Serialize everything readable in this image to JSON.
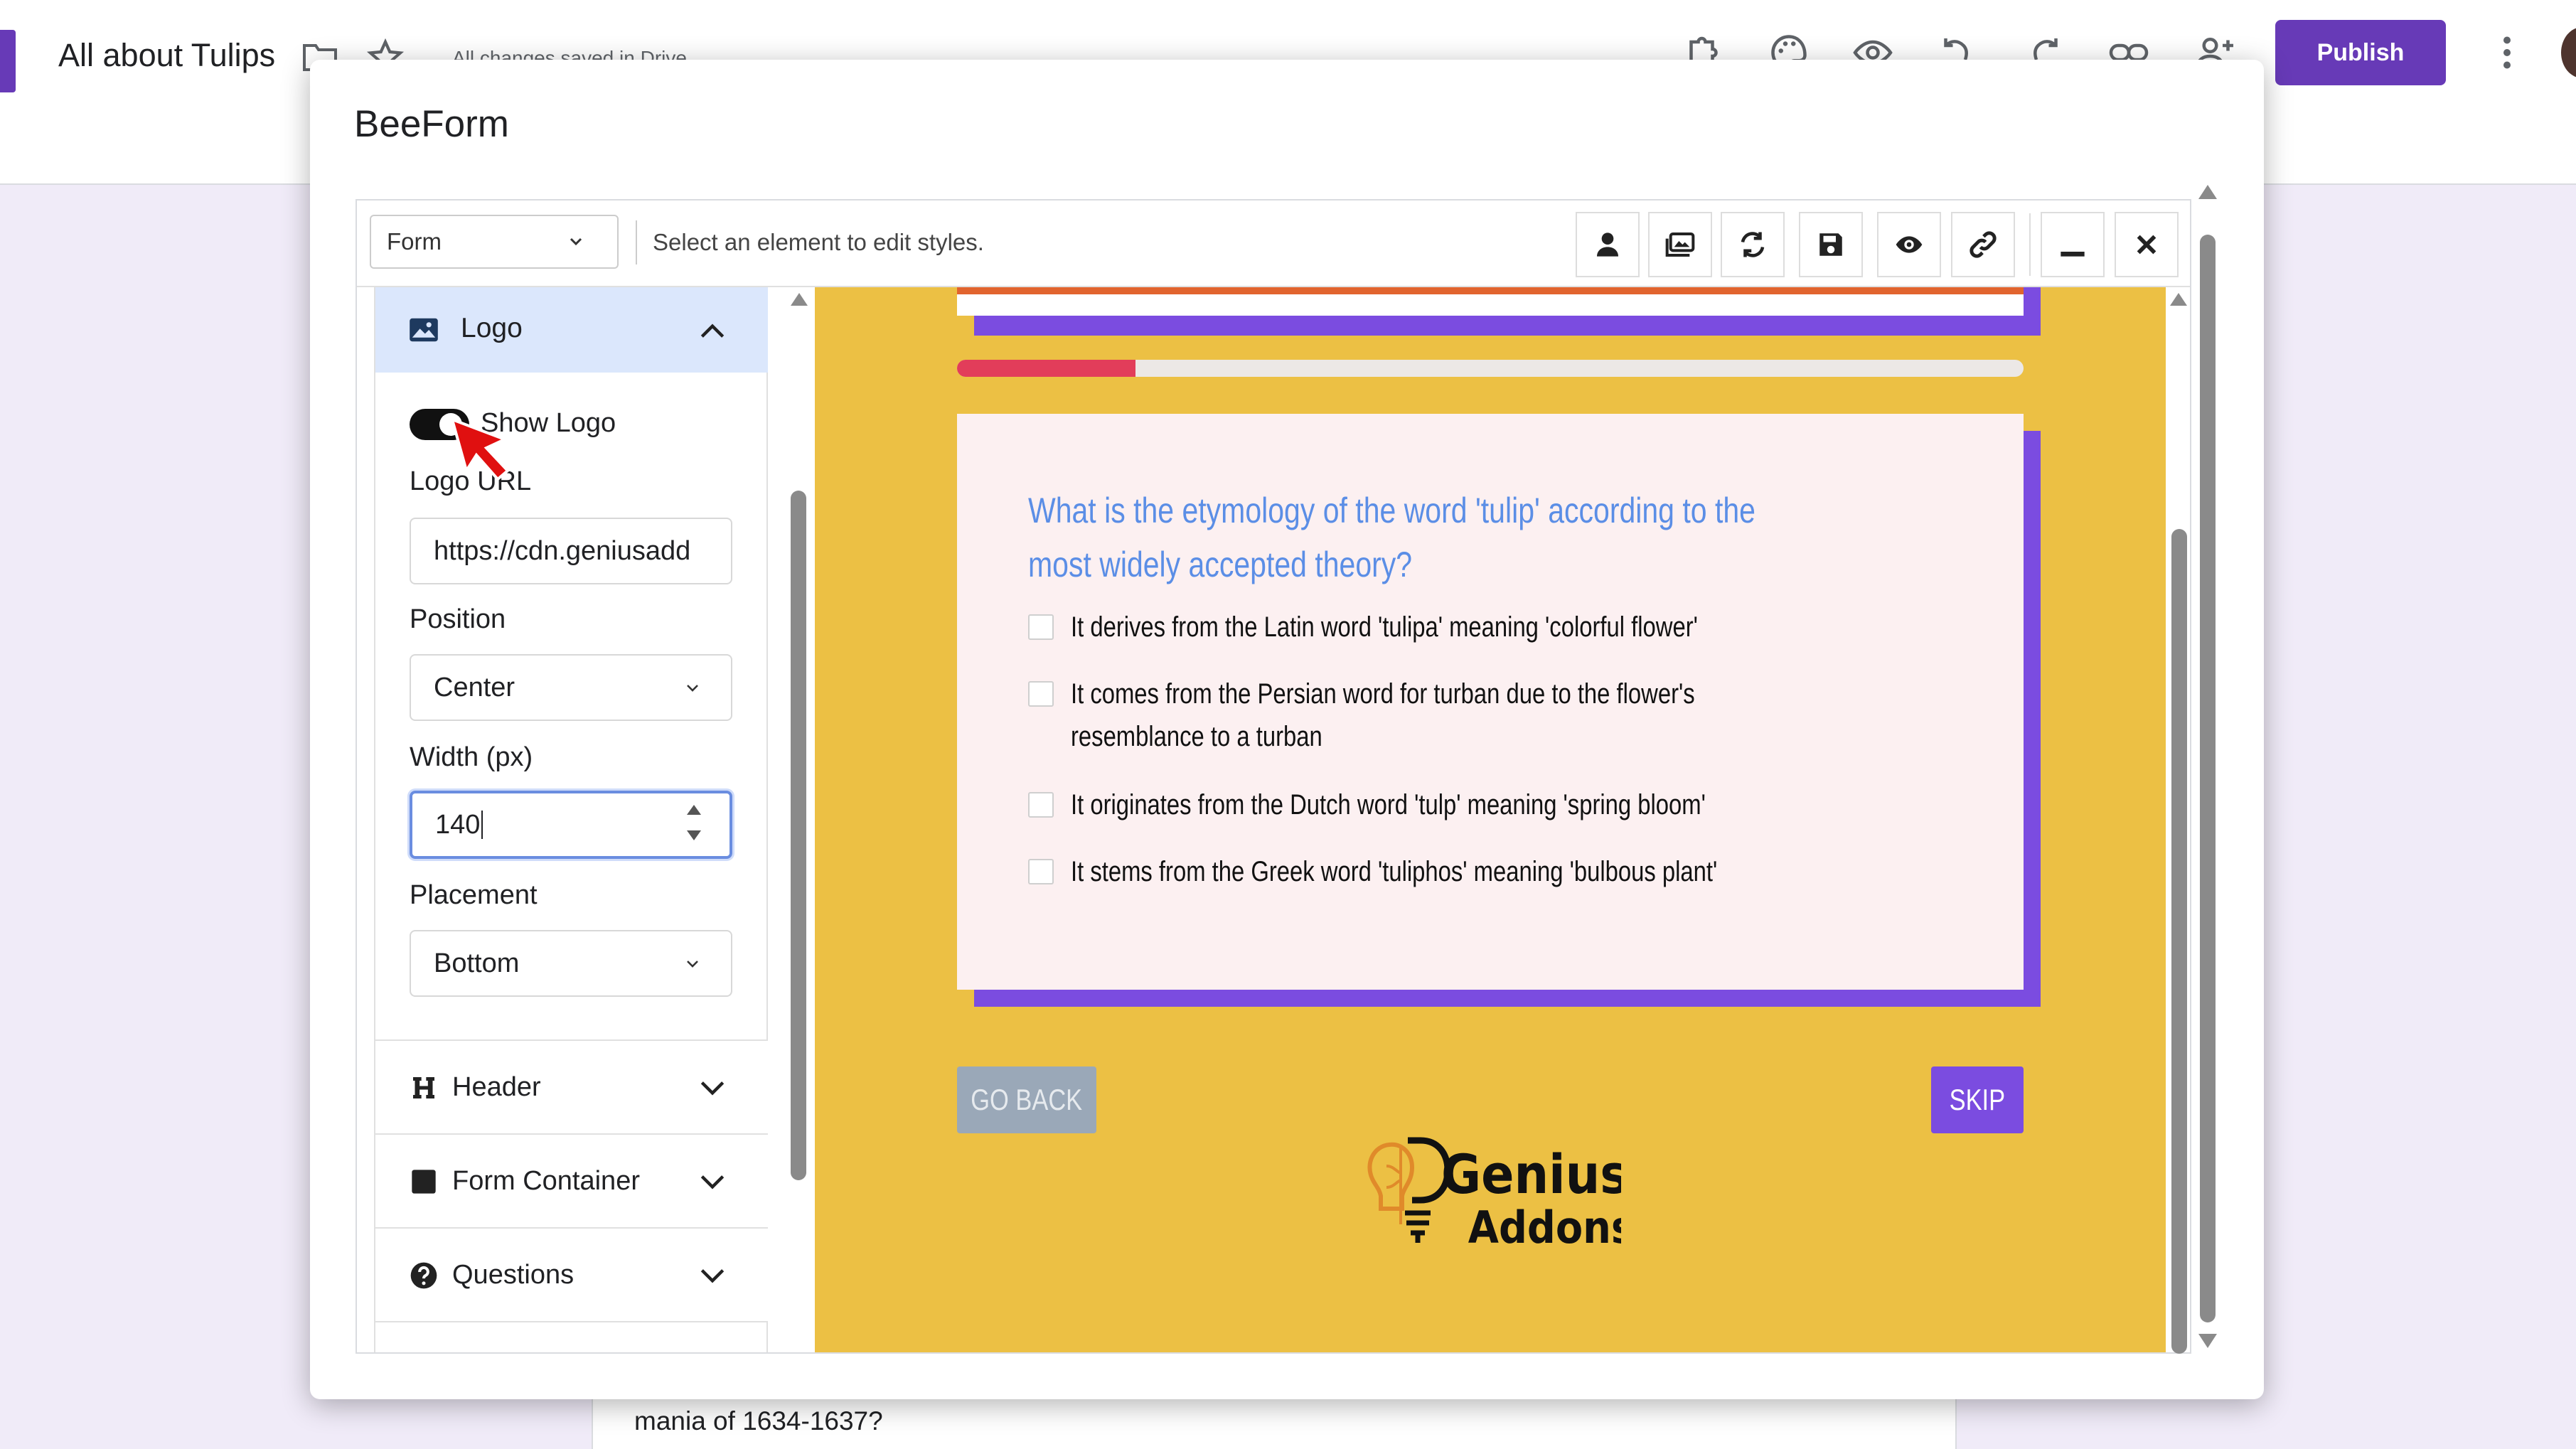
{
  "topbar": {
    "doc_title": "All about Tulips",
    "save_status": "All changes saved in Drive",
    "publish_label": "Publish",
    "icons": [
      "folder-icon",
      "star-icon",
      "addons-icon",
      "palette-icon",
      "preview-icon",
      "undo-icon",
      "redo-icon",
      "link-icon",
      "add-collaborator-icon",
      "more-icon"
    ],
    "accent": "#673ab7"
  },
  "background": {
    "question_text": "mania of 1634-1637?"
  },
  "dialog": {
    "title": "BeeForm"
  },
  "toolbar": {
    "form_select": "Form",
    "hint": "Select an element to edit styles.",
    "tools": [
      "user-icon",
      "images-icon",
      "refresh-icon",
      "save-icon",
      "eye-icon",
      "link-icon",
      "minimize-icon",
      "close-icon"
    ]
  },
  "sidebar": {
    "logo_section": {
      "label": "Logo",
      "show_logo_label": "Show Logo",
      "show_logo": true,
      "logo_url_label": "Logo URL",
      "logo_url_value": "https://cdn.geniusadd",
      "position_label": "Position",
      "position_value": "Center",
      "width_label": "Width (px)",
      "width_value": "140",
      "placement_label": "Placement",
      "placement_value": "Bottom"
    },
    "sections": [
      {
        "label": "Header",
        "icon": "header-icon"
      },
      {
        "label": "Form Container",
        "icon": "square-icon"
      },
      {
        "label": "Questions",
        "icon": "question-circle-icon"
      }
    ]
  },
  "preview": {
    "background_color": "#ecc044",
    "accent_purple": "#7b4ce0",
    "progress_color": "#e23d5a",
    "progress_fraction": 0.167,
    "question": "What is the etymology of the word 'tulip' according to the most widely accepted theory?",
    "options": [
      "It derives from the Latin word 'tulipa' meaning 'colorful flower'",
      "It comes from the Persian word for turban due to the flower's resemblance to a turban",
      "It originates from the Dutch word 'tulp' meaning 'spring bloom'",
      "It stems from the Greek word 'tuliphos' meaning 'bulbous plant'"
    ],
    "back_label": "GO BACK",
    "skip_label": "SKIP",
    "logo_text_1": "Genius",
    "logo_text_2": "Addons"
  }
}
